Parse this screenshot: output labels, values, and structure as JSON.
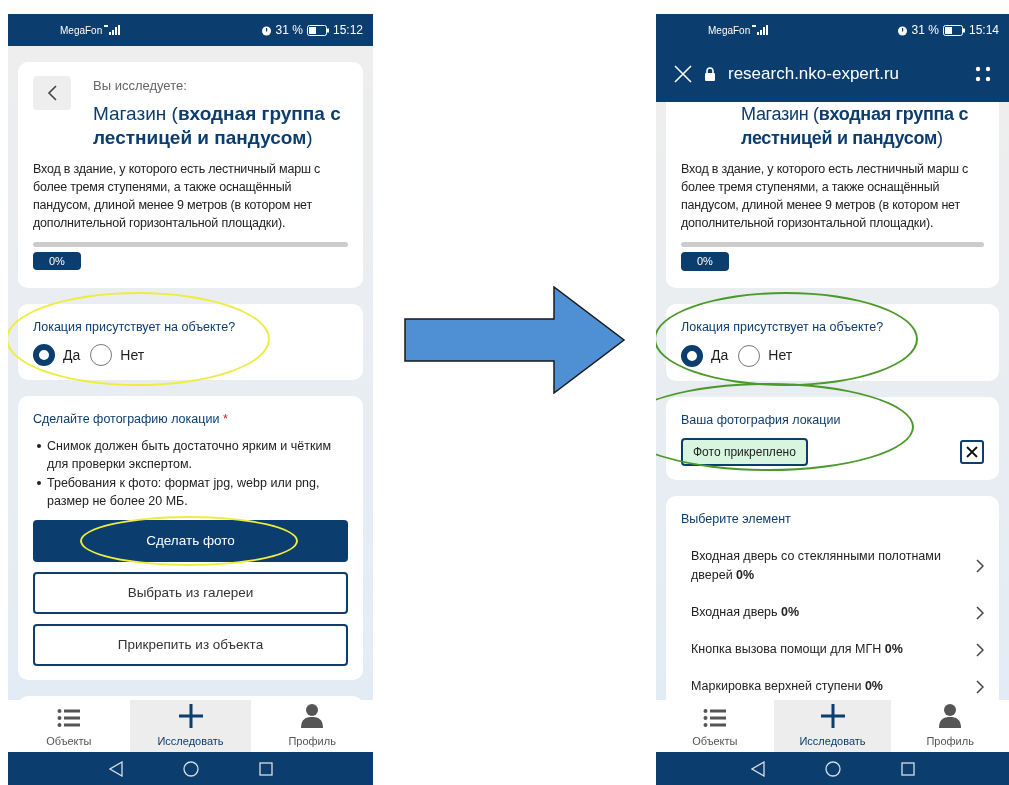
{
  "phones": [
    {
      "status": {
        "carrier": "MegaFon",
        "battery": "31 %",
        "time": "15:12"
      },
      "header": {
        "prefix": "Вы исследуете:",
        "title": "Магазин (**входная группа с лестницей и пандусом**)",
        "description": "Вход в здание, у которого есть лестничный марш с более тремя ступенями, а также оснащённый пандусом, длиной менее 9 метров (в котором нет дополнительной горизонтальной площадки).",
        "progress": {
          "level": 0,
          "label": "0%"
        }
      },
      "question": {
        "label": "Локация присутствует на объекте?",
        "highlight": {
          "color": "#eeec3c"
        },
        "options": [
          {
            "label": "Да",
            "selected": true
          },
          {
            "label": "Нет",
            "selected": false
          }
        ]
      },
      "photo": {
        "kind": "prompt",
        "title": "Сделайте фотографию локации",
        "required": "*",
        "bullets": [
          "Снимок должен быть достаточно ярким и чётким для проверки экспертом.",
          "Требования к фото: формат jpg, webp или png, размер не более 20 МБ."
        ],
        "buttons": [
          {
            "label": "Сделать фото",
            "kind": "primary",
            "highlight": {
              "color": "#eeec3c"
            }
          },
          {
            "label": "Выбрать из галереи",
            "kind": "outline"
          },
          {
            "label": "Прикрепить из объекта",
            "kind": "outline"
          }
        ]
      },
      "nav": [
        {
          "label": "Объекты",
          "selected": false
        },
        {
          "label": "Исследовать",
          "selected": true
        },
        {
          "label": "Профиль",
          "selected": false
        }
      ]
    },
    {
      "status": {
        "carrier": "MegaFon",
        "battery": "31 %",
        "time": "15:14"
      },
      "browser": {
        "url": "research.nko-expert.ru"
      },
      "header": {
        "title": "Магазин (**входная группа с лестницей и пандусом**)",
        "description": "Вход в здание, у которого есть лестничный марш с более тремя ступенями, а также оснащённый пандусом, длиной менее 9 метров (в котором нет дополнительной горизонтальной площадки).",
        "progress": {
          "level": 0,
          "label": "0%"
        }
      },
      "question": {
        "label": "Локация присутствует на объекте?",
        "highlight": {
          "color": "#4a9a2a"
        },
        "options": [
          {
            "label": "Да",
            "selected": true
          },
          {
            "label": "Нет",
            "selected": false
          }
        ]
      },
      "photo": {
        "kind": "attached",
        "title": "Ваша фотография локации",
        "chip": "Фото прикреплено",
        "highlight": {
          "color": "#4a9a2a"
        }
      },
      "elements": {
        "title": "Выберите элемент",
        "items": [
          {
            "label": "Входная дверь со стеклянными полотнами дверей **0%**"
          },
          {
            "label": "Входная дверь **0%**"
          },
          {
            "label": "Кнопка вызова помощи для МГН **0%**"
          },
          {
            "label": "Маркировка верхней ступени **0%**"
          }
        ]
      },
      "nav": [
        {
          "label": "Объекты",
          "selected": false
        },
        {
          "label": "Исследовать",
          "selected": true
        },
        {
          "label": "Профиль",
          "selected": false
        }
      ]
    }
  ]
}
